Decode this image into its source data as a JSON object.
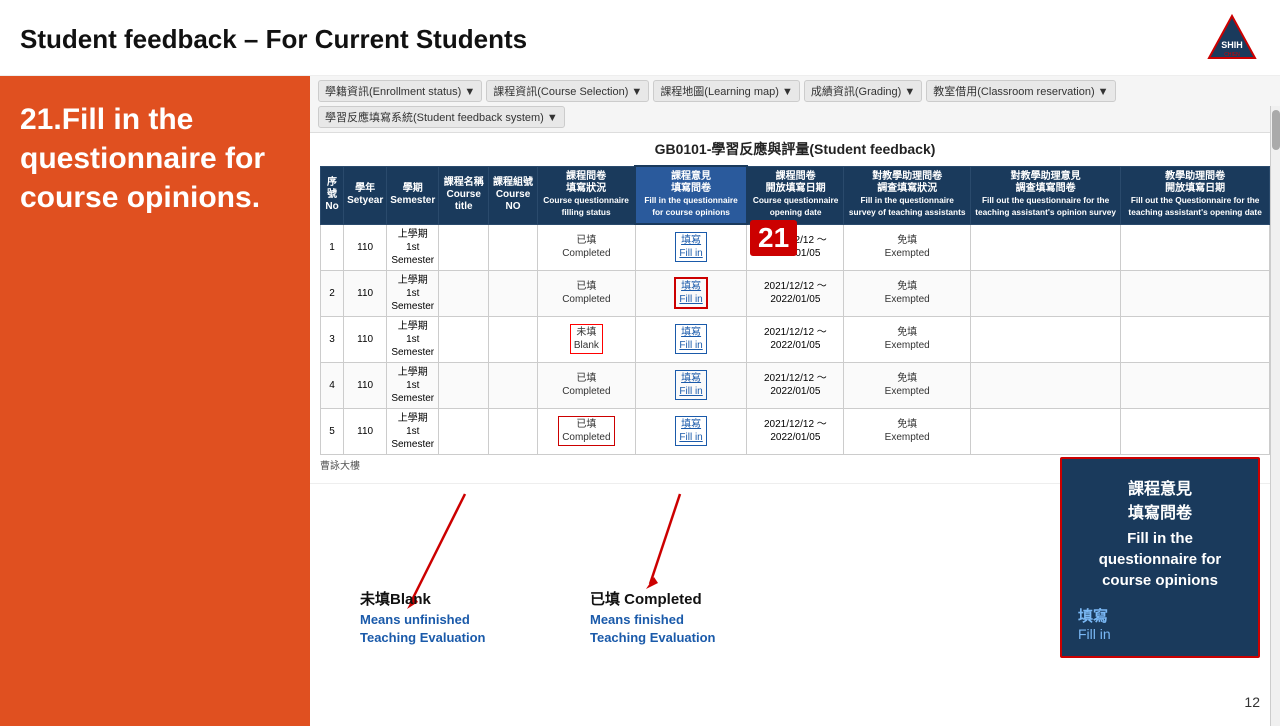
{
  "header": {
    "title": "Student feedback – For Current Students",
    "page_number": "12"
  },
  "sidebar": {
    "step": "21.Fill in the questionnaire for course opinions."
  },
  "nav": {
    "items": [
      "學籍資訊(Enrollment status) ▼",
      "課程資訊(Course Selection) ▼",
      "課程地圖(Learning map) ▼",
      "成績資訊(Grading) ▼",
      "教室借用(Classroom reservation) ▼",
      "學習反應填寫系統(Student feedback system) ▼"
    ]
  },
  "table": {
    "title": "GB0101-學習反應與評量(Student feedback)",
    "headers": [
      {
        "zh": "序號",
        "en": "No"
      },
      {
        "zh": "學年",
        "en": "Setyear"
      },
      {
        "zh": "學期",
        "en": "Semester"
      },
      {
        "zh": "課程名稱",
        "en": "Course title"
      },
      {
        "zh": "課程組號",
        "en": "Course NO"
      },
      {
        "zh": "課程問卷填寫狀況",
        "en": "Course questionnaire filling status"
      },
      {
        "zh": "課程意見填寫問卷",
        "en": "Fill in the questionnaire for course opinions"
      },
      {
        "zh": "課程問卷開放填寫日期",
        "en": "Course questionnaire opening date"
      },
      {
        "zh": "對教學助理問卷調查填寫狀況",
        "en": "Fill in the questionnaire survey of teaching assistants"
      },
      {
        "zh": "對教學助理意見調查填寫問卷",
        "en": "Fill out the questionnaire for the teaching assistant's opinion survey"
      },
      {
        "zh": "教學助理問卷開放填寫日期",
        "en": "Fill out the Questionnaire for the teaching assistant's opening date"
      }
    ],
    "rows": [
      {
        "no": "1",
        "year": "110",
        "semester": "上學期\n1st\nSemester",
        "course": "",
        "course_no": "",
        "fill_status": "已填\nCompleted",
        "fill_link": "填寫\nFill in",
        "date": "2021/12/12～\n2022/01/05",
        "ta_status": "免填\nExempted",
        "ta_link": "",
        "ta_date": ""
      },
      {
        "no": "2",
        "year": "110",
        "semester": "上學期\n1st\nSemester",
        "course": "",
        "course_no": "",
        "fill_status": "已填\nCompleted",
        "fill_link": "填寫\nFill in",
        "date": "2021/12/12～\n2022/01/05",
        "ta_status": "免填\nExempted",
        "ta_link": "",
        "ta_date": ""
      },
      {
        "no": "3",
        "year": "110",
        "semester": "上學期\n1st\nSemester",
        "course": "",
        "course_no": "",
        "fill_status": "未填\nBlank",
        "fill_link": "填寫\nFill in",
        "date": "2021/12/12～\n2022/01/05",
        "ta_status": "免填\nExempted",
        "ta_link": "",
        "ta_date": ""
      },
      {
        "no": "4",
        "year": "110",
        "semester": "上學期\n1st\nSemester",
        "course": "",
        "course_no": "",
        "fill_status": "已填\nCompleted",
        "fill_link": "填寫\nFill in",
        "date": "2021/12/12～\n2022/01/05",
        "ta_status": "免填\nExempted",
        "ta_link": "",
        "ta_date": ""
      },
      {
        "no": "5",
        "year": "110",
        "semester": "上學期\n1st\nSemester",
        "course": "",
        "course_no": "",
        "fill_status": "已填\nCompleted",
        "fill_link": "填寫\nFill in",
        "date": "2021/12/12～\n2022/01/05",
        "ta_status": "免填\nExempted",
        "ta_link": "",
        "ta_date": ""
      }
    ]
  },
  "annotations": {
    "blank_label": "未填Blank",
    "blank_desc_line1": "Means unfinished",
    "blank_desc_line2": "Teaching Evaluation",
    "completed_label": "已填 Completed",
    "completed_desc_line1": "Means finished",
    "completed_desc_line2": "Teaching Evaluation"
  },
  "info_card": {
    "title_zh_line1": "課程意見",
    "title_zh_line2": "填寫問卷",
    "title_en": "Fill in the questionnaire for course opinions",
    "link_zh": "填寫",
    "link_en": "Fill in"
  },
  "campus_label": "曹詠大樓",
  "badge_number": "21"
}
